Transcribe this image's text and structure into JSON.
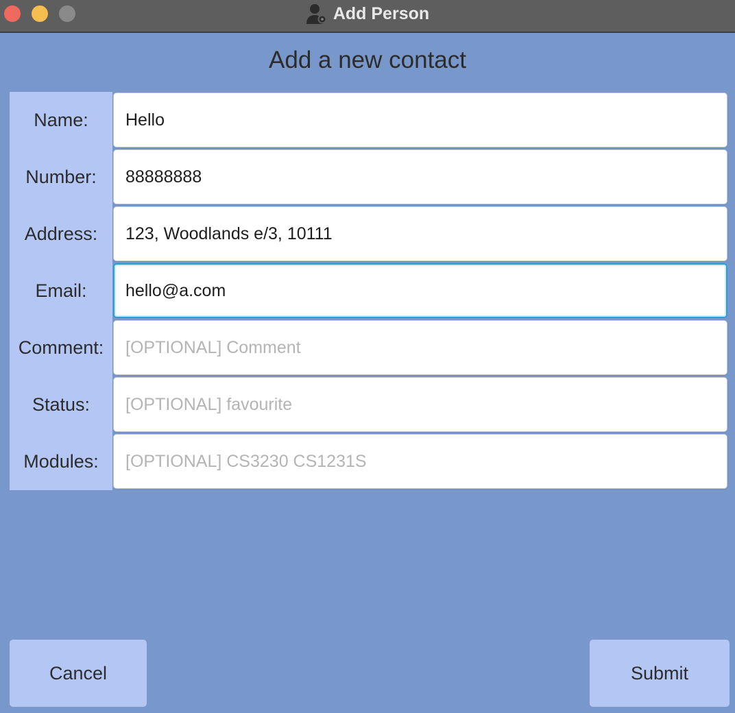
{
  "window": {
    "title": "Add Person",
    "title_icon": "person-add-icon"
  },
  "dialog": {
    "heading": "Add a new contact"
  },
  "form": {
    "fields": [
      {
        "label": "Name:",
        "value": "Hello",
        "placeholder": ""
      },
      {
        "label": "Number:",
        "value": "88888888",
        "placeholder": ""
      },
      {
        "label": "Address:",
        "value": "123, Woodlands e/3, 10111",
        "placeholder": ""
      },
      {
        "label": "Email:",
        "value": "hello@a.com",
        "placeholder": "",
        "focused": true
      },
      {
        "label": "Comment:",
        "value": "",
        "placeholder": "[OPTIONAL] Comment"
      },
      {
        "label": "Status:",
        "value": "",
        "placeholder": "[OPTIONAL] favourite"
      },
      {
        "label": "Modules:",
        "value": "",
        "placeholder": "[OPTIONAL] CS3230 CS1231S"
      }
    ]
  },
  "buttons": {
    "cancel": "Cancel",
    "submit": "Submit"
  },
  "colors": {
    "window_bg": "#7898cc",
    "label_bg": "#b4c6f4",
    "titlebar_bg": "#5e5e5e",
    "focus_ring": "#2aa0d6",
    "close": "#ee6a5f",
    "minimize": "#f5be4f",
    "maximize": "#8a8a8a"
  }
}
